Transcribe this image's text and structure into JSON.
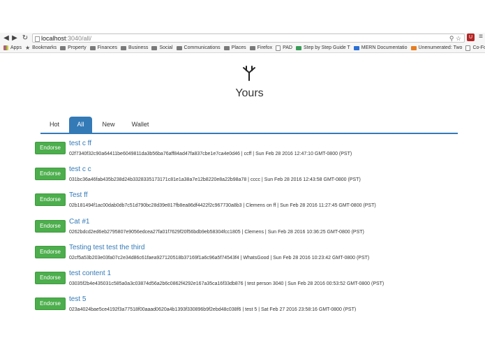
{
  "browser": {
    "url_host": "localhost",
    "url_path": ":3040/all/",
    "bookmarks": [
      {
        "label": "Apps",
        "icon": "apps-icon"
      },
      {
        "label": "Bookmarks",
        "icon": "star-icon"
      },
      {
        "label": "Property",
        "icon": "folder-icon"
      },
      {
        "label": "Finances",
        "icon": "folder-icon"
      },
      {
        "label": "Business",
        "icon": "folder-icon"
      },
      {
        "label": "Social",
        "icon": "folder-icon"
      },
      {
        "label": "Communications",
        "icon": "folder-icon"
      },
      {
        "label": "Places",
        "icon": "folder-icon"
      },
      {
        "label": "Firefox",
        "icon": "folder-icon"
      },
      {
        "label": "PAD",
        "icon": "doc-icon"
      },
      {
        "label": "Step by Step Guide T",
        "icon": "guide-icon"
      },
      {
        "label": "MERN Documentatio",
        "icon": "mern-icon"
      },
      {
        "label": "Unenumerated: Two",
        "icon": "blogger-icon"
      },
      {
        "label": "Co-Founder Equity C",
        "icon": "doc-icon"
      }
    ]
  },
  "page": {
    "title": "Yours",
    "tabs": [
      "Hot",
      "All",
      "New",
      "Wallet"
    ],
    "active_tab": "All"
  },
  "posts": [
    {
      "title": "test c ff",
      "hash": "02f7340f32c90a64411be6049811da3b56ba76aff84ad47fa837cbe1e7ca4e0d46",
      "author": "ccff",
      "date": "Sun Feb 28 2016 12:47:10 GMT-0800 (PST)",
      "button": "Endorse"
    },
    {
      "title": "test c c",
      "hash": "031bc36a46fab435b238d24b3328335173171c81e1a38a7e12b8220e8a22b98a78",
      "author": "cccc",
      "date": "Sun Feb 28 2016 12:43:58 GMT-0800 (PST)",
      "button": "Endorse"
    },
    {
      "title": "Test ff",
      "hash": "02b181494f1ac00dab0db7c51d790bc28d39e817fb8ea86df4422f2c967730a8b3",
      "author": "Clemens on ff",
      "date": "Sun Feb 28 2016 11:27:45 GMT-0800 (PST)",
      "button": "Endorse"
    },
    {
      "title": "Cat #1",
      "hash": "0262bdcd2ed6eb2795807e9056edcea27fa01f7629f20f56bdb9eb58304fcc1805",
      "author": "Clemens",
      "date": "Sun Feb 28 2016 10:36:25 GMT-0800 (PST)",
      "button": "Endorse"
    },
    {
      "title": "Testing test test the third",
      "hash": "02cf5a53b203e03fa07c2e34d86c61faea927120518b37169f1a6c96a5f74543f4",
      "author": "WhatsGood",
      "date": "Sun Feb 28 2016 10:23:42 GMT-0800 (PST)",
      "button": "Endorse"
    },
    {
      "title": "test content 1",
      "hash": "03035f2b4e435031c585a0a3c03874d56a2b6c0862f4292e167a35ca16f33db876",
      "author": "test person 3040",
      "date": "Sun Feb 28 2016 00:53:52 GMT-0800 (PST)",
      "button": "Endorse"
    },
    {
      "title": "test 5",
      "hash": "023a4024bae5ce4192f3a77518f00aaad0620a4b1393f330896b9f2ebd48c038f6",
      "author": "test 5",
      "date": "Sat Feb 27 2016 23:58:16 GMT-0800 (PST)",
      "button": "Endorse"
    }
  ]
}
